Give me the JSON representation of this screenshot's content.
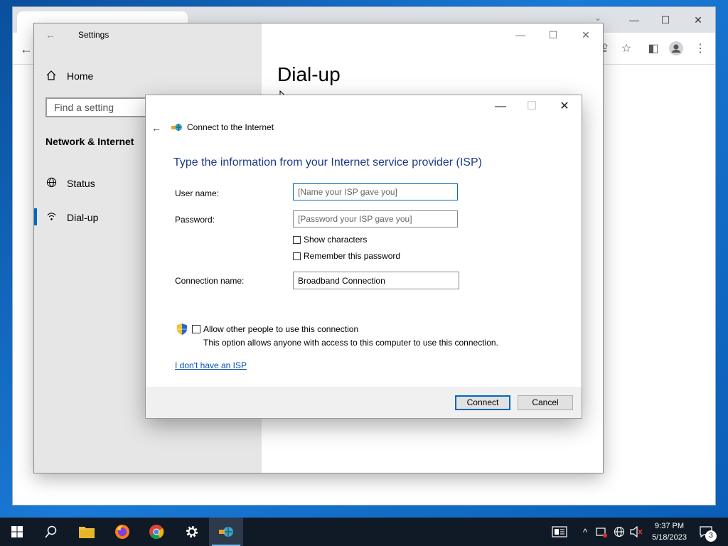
{
  "settings": {
    "window_title": "Settings",
    "nav_home": "Home",
    "search_placeholder": "Find a setting",
    "section_title": "Network & Internet",
    "nav_items": [
      {
        "label": "Status",
        "icon": "globe-icon"
      },
      {
        "label": "Dial-up",
        "icon": "dialup-icon"
      }
    ],
    "page_heading": "Dial-up"
  },
  "dialog": {
    "title": "Connect to the Internet",
    "heading": "Type the information from your Internet service provider (ISP)",
    "username_label": "User name:",
    "username_placeholder": "[Name your ISP gave you]",
    "password_label": "Password:",
    "password_placeholder": "[Password your ISP gave you]",
    "show_characters": "Show characters",
    "remember_password": "Remember this password",
    "connection_name_label": "Connection name:",
    "connection_name_value": "Broadband Connection",
    "allow_others": "Allow other people to use this connection",
    "allow_others_note": "This option allows anyone with access to this computer to use this connection.",
    "no_isp_link": "I don't have an ISP",
    "connect_button": "Connect",
    "cancel_button": "Cancel"
  },
  "taskbar": {
    "time": "9:37 PM",
    "date": "5/18/2023",
    "notification_count": "3"
  },
  "colors": {
    "accent": "#0067c0",
    "heading_blue": "#1e3a8a",
    "link": "#0050b5"
  }
}
